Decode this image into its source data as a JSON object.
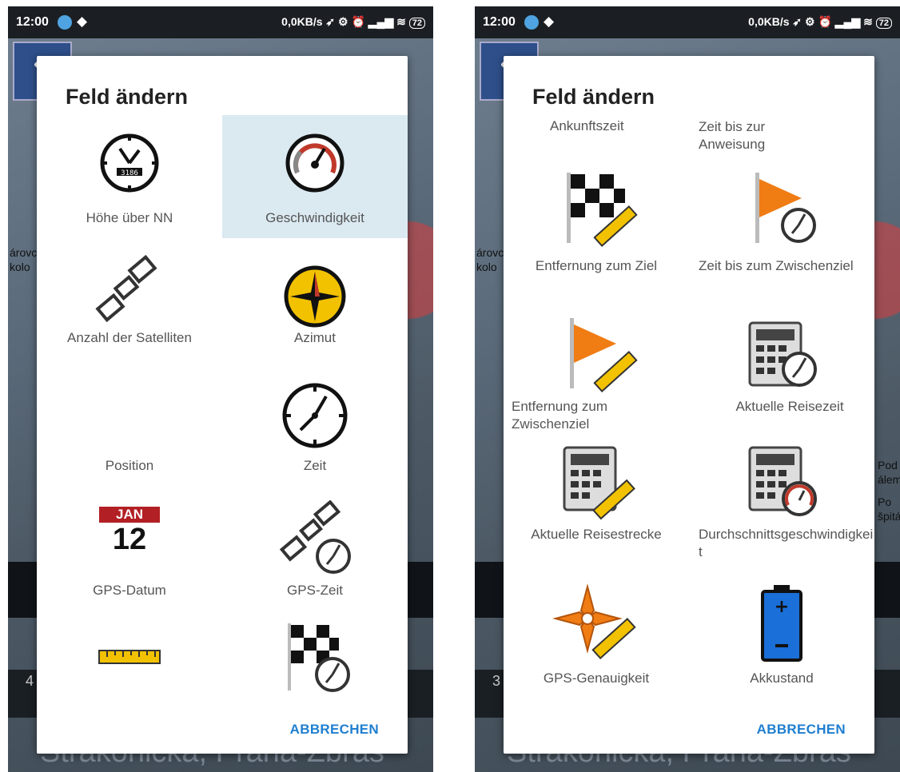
{
  "left": {
    "status": {
      "time": "12:00",
      "net": "0,0KB/s",
      "battery": "72"
    },
    "dialog": {
      "title": "Feld ändern",
      "cancel": "ABBRECHEN",
      "items": [
        {
          "label": "Höhe über NN",
          "icon": "altitude-clock-icon",
          "highlight": false
        },
        {
          "label": "Geschwindigkeit",
          "icon": "speedometer-icon",
          "highlight": true
        },
        {
          "label": "Anzahl der Satelliten",
          "icon": "satellite-icon",
          "highlight": false
        },
        {
          "label": "Azimut",
          "icon": "compass-icon",
          "highlight": false
        },
        {
          "label": "Position",
          "icon": "",
          "highlight": false
        },
        {
          "label": "Zeit",
          "icon": "clock-icon",
          "highlight": false
        },
        {
          "label": "GPS-Datum",
          "icon": "calendar-icon",
          "highlight": false
        },
        {
          "label": "GPS-Zeit",
          "icon": "satellite-clock-icon",
          "highlight": false
        },
        {
          "label": "",
          "icon": "ruler-icon",
          "highlight": false
        },
        {
          "label": "",
          "icon": "finish-flag-clock-icon",
          "highlight": false
        }
      ],
      "calendar": {
        "month": "JAN",
        "day": "12"
      },
      "altitude_digits": "3186"
    },
    "map": {
      "street": "Strakonická, Praha-Zbras",
      "side_a": "árovc",
      "side_b": "kolo",
      "side_c": "4"
    }
  },
  "right": {
    "status": {
      "time": "12:00",
      "net": "0,0KB/s",
      "battery": "72"
    },
    "dialog": {
      "title": "Feld ändern",
      "cancel": "ABBRECHEN",
      "top_labels": [
        "Ankunftszeit",
        "Zeit bis zur Anweisung"
      ],
      "items": [
        {
          "label": "Entfernung zum Ziel",
          "icon": "finish-flag-ruler-icon"
        },
        {
          "label": "Zeit bis zum Zwischenziel",
          "icon": "waypoint-flag-clock-icon"
        },
        {
          "label": "Entfernung zum Zwischenziel",
          "icon": "waypoint-flag-ruler-icon"
        },
        {
          "label": "Aktuelle Reisezeit",
          "icon": "calculator-clock-icon"
        },
        {
          "label": "Aktuelle Reisestrecke",
          "icon": "calculator-ruler-icon"
        },
        {
          "label": "Durchschnittsgeschwindigkeit",
          "icon": "calculator-speedometer-icon"
        },
        {
          "label": "GPS-Genauigkeit",
          "icon": "gps-accuracy-icon"
        },
        {
          "label": "Akkustand",
          "icon": "battery-icon"
        }
      ]
    },
    "map": {
      "street": "Strakonická, Praha-Zbras",
      "side_a": "árovc",
      "side_b": "kolo",
      "side_c": "3",
      "side_d": "Pod",
      "side_e": "álem",
      "side_f": "Po",
      "side_g": "špitá"
    }
  }
}
